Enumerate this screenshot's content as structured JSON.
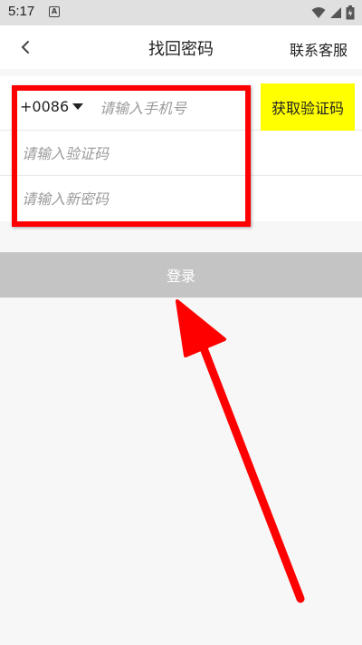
{
  "status_bar": {
    "time": "5:17",
    "notification_icon": "a-icon",
    "icons": [
      "wifi-icon",
      "signal-icon",
      "battery-icon"
    ]
  },
  "header": {
    "back_icon": "chevron-left-icon",
    "title": "找回密码",
    "service_link": "联系客服"
  },
  "form": {
    "country_code": "+0086",
    "phone_placeholder": "请输入手机号",
    "code_placeholder": "请输入验证码",
    "password_placeholder": "请输入新密码",
    "get_code_label": "获取验证码"
  },
  "login_button": {
    "label": "登录"
  },
  "colors": {
    "accent_yellow": "#ffff00",
    "annotation_red": "#ff0000",
    "login_disabled": "#c4c4c4"
  }
}
